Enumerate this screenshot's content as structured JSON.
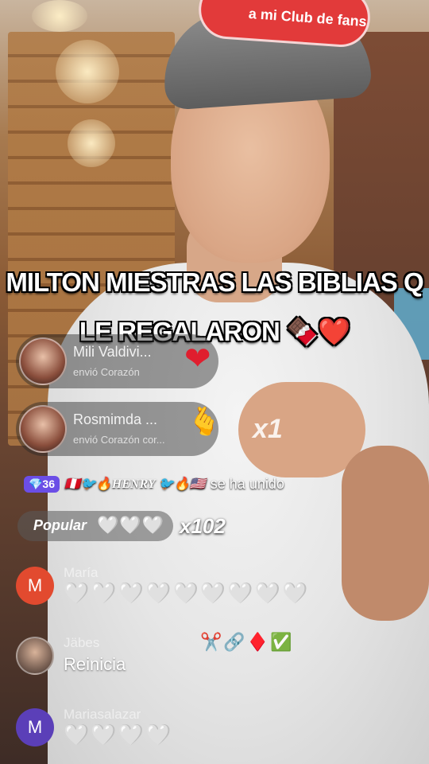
{
  "video": {
    "cap_patch_text": "a mi Club de fans",
    "caption_line1": "MILTON MIESTRAS LAS BIBLIAS Q",
    "caption_line2": "LE REGALARON 🍫❤️"
  },
  "gift_toasts": [
    {
      "name": "Mili Valdivi...",
      "action": "envió  Corazón"
    },
    {
      "name": "Rosmimda ...",
      "action": "envió  Corazón cor..."
    }
  ],
  "gift_multiplier": "x1",
  "join_notice": {
    "level_badge": "💎36",
    "user": "🇵🇪🐦🔥HENRY 🐦🔥🇺🇸",
    "message": "se ha unido"
  },
  "popular": {
    "label": "Popular",
    "hearts": "🤍🤍🤍",
    "count": "x102"
  },
  "comments": [
    {
      "avatar_letter": "M",
      "name": "María",
      "text": "🤍🤍🤍🤍🤍🤍🤍🤍🤍",
      "accent": "#e24a2f"
    },
    {
      "avatar_letter": "",
      "name": "Jäbes",
      "text": "Reinicia",
      "badges": "✂️🔗♦️✅"
    },
    {
      "avatar_letter": "M",
      "name": "Mariasalazar",
      "text": "🤍🤍🤍🤍",
      "accent": "#5b3fb8"
    }
  ]
}
